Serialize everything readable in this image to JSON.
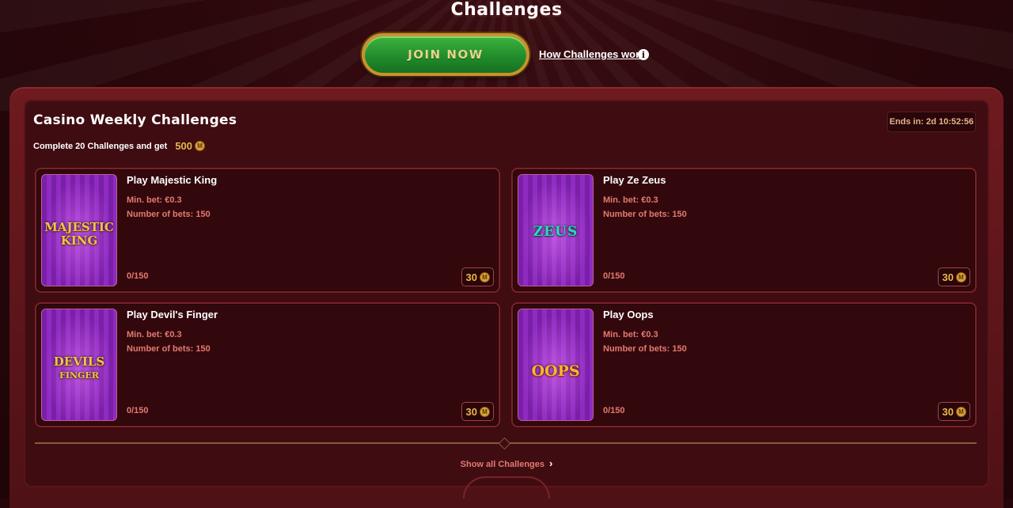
{
  "header": {
    "title": "Challenges",
    "join_label": "JOIN NOW",
    "how_link": "How Challenges work",
    "info_glyph": "i"
  },
  "panel": {
    "title": "Casino Weekly Challenges",
    "subtitle": "Complete 20 Challenges and get",
    "reward": "500",
    "coin_glyph": "M",
    "ends_in": "Ends in: 2d 10:52:56"
  },
  "challenges": [
    {
      "title": "Play Majestic King",
      "min_bet": "Min. bet: €0.3",
      "bets": "Number of bets: 150",
      "progress": "0/150",
      "points": "30",
      "logo_top": "MAJESTIC",
      "logo_bottom": "KING",
      "icon": "lion-icon"
    },
    {
      "title": "Play Ze Zeus",
      "min_bet": "Min. bet: €0.3",
      "bets": "Number of bets: 150",
      "progress": "0/150",
      "points": "30",
      "logo_top": "ZEUS",
      "logo_bottom": "",
      "icon": "lightning-icon"
    },
    {
      "title": "Play Devil's Finger",
      "min_bet": "Min. bet: €0.3",
      "bets": "Number of bets: 150",
      "progress": "0/150",
      "points": "30",
      "logo_top": "DEVILS",
      "logo_bottom": "FINGER",
      "icon": "devil-icon"
    },
    {
      "title": "Play Oops",
      "min_bet": "Min. bet: €0.3",
      "bets": "Number of bets: 150",
      "progress": "0/150",
      "points": "30",
      "logo_top": "OOPS",
      "logo_bottom": "",
      "icon": "mouse-icon"
    }
  ],
  "footer": {
    "show_all": "Show all Challenges",
    "chevron": "›"
  },
  "colors": {
    "background": "#2a070b",
    "panel": "#3f0c11",
    "accent_gold": "#e7b84a",
    "accent_green": "#2a9a33",
    "meta_text": "#e37a6e"
  }
}
